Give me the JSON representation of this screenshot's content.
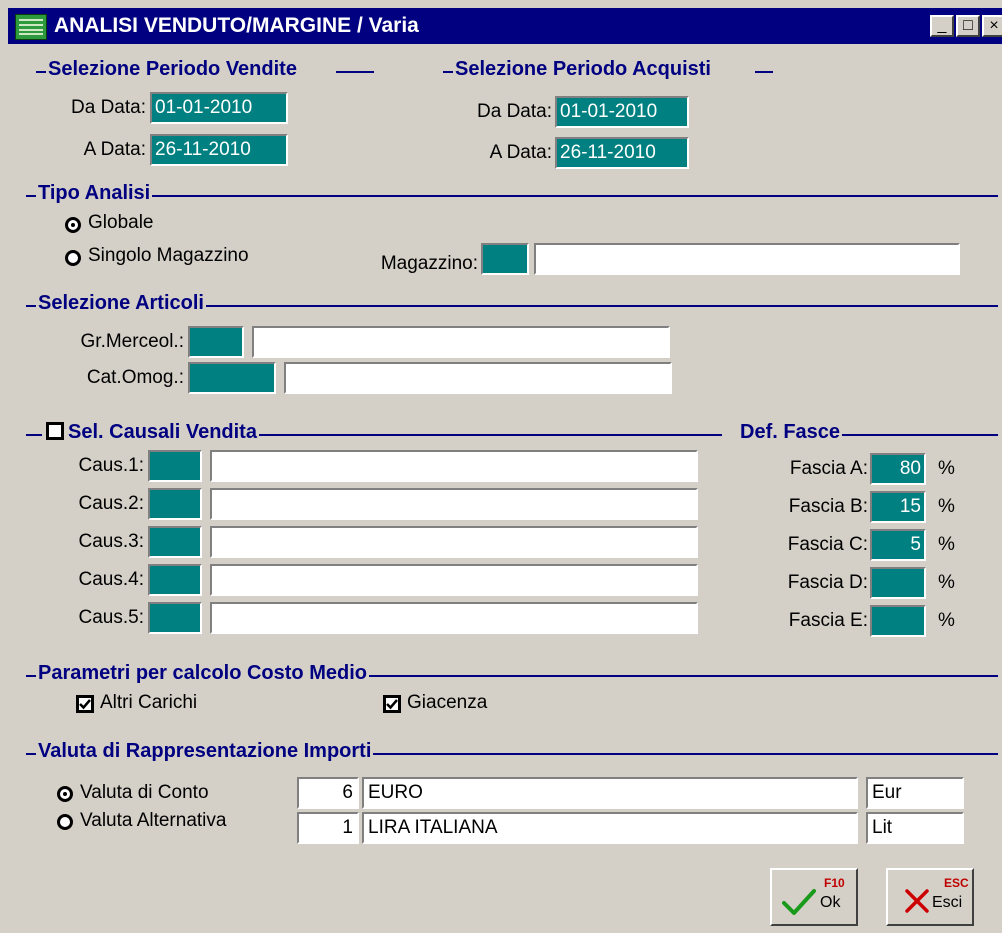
{
  "window": {
    "title": "ANALISI VENDUTO/MARGINE / Varia",
    "minimize_glyph": "_",
    "maximize_glyph": "□",
    "close_glyph": "×"
  },
  "periodo_vendite": {
    "title": "Selezione Periodo Vendite",
    "da_label": "Da Data:",
    "da_value": "01-01-2010",
    "a_label": "A Data:",
    "a_value": "26-11-2010"
  },
  "periodo_acquisti": {
    "title": "Selezione Periodo Acquisti",
    "da_label": "Da Data:",
    "da_value": "01-01-2010",
    "a_label": "A Data:",
    "a_value": "26-11-2010"
  },
  "tipo_analisi": {
    "title": "Tipo Analisi",
    "options": [
      "Globale",
      "Singolo Magazzino"
    ],
    "selected": "Globale",
    "magazzino_label": "Magazzino:",
    "magazzino_code": "",
    "magazzino_desc": ""
  },
  "selezione_articoli": {
    "title": "Selezione Articoli",
    "gr_merceol_label": "Gr.Merceol.:",
    "gr_merceol_code": "",
    "gr_merceol_desc": "",
    "cat_omog_label": "Cat.Omog.:",
    "cat_omog_code": "",
    "cat_omog_desc": ""
  },
  "causali": {
    "title": "Sel. Causali Vendita",
    "checked": false,
    "rows": [
      {
        "label": "Caus.1:",
        "code": "",
        "desc": ""
      },
      {
        "label": "Caus.2:",
        "code": "",
        "desc": ""
      },
      {
        "label": "Caus.3:",
        "code": "",
        "desc": ""
      },
      {
        "label": "Caus.4:",
        "code": "",
        "desc": ""
      },
      {
        "label": "Caus.5:",
        "code": "",
        "desc": ""
      }
    ]
  },
  "fasce": {
    "title": "Def. Fasce",
    "unit": "%",
    "rows": [
      {
        "label": "Fascia A:",
        "value": "80"
      },
      {
        "label": "Fascia B:",
        "value": "15"
      },
      {
        "label": "Fascia C:",
        "value": "5"
      },
      {
        "label": "Fascia D:",
        "value": ""
      },
      {
        "label": "Fascia E:",
        "value": ""
      }
    ]
  },
  "costo_medio": {
    "title": "Parametri per calcolo Costo Medio",
    "altri_carichi_label": "Altri Carichi",
    "altri_carichi_checked": true,
    "giacenza_label": "Giacenza",
    "giacenza_checked": true
  },
  "valuta": {
    "title": "Valuta di Rappresentazione Importi",
    "selected": "Valuta di Conto",
    "rows": [
      {
        "label": "Valuta di Conto",
        "code": "6",
        "name": "EURO",
        "symbol": "Eur"
      },
      {
        "label": "Valuta Alternativa",
        "code": "1",
        "name": "LIRA ITALIANA",
        "symbol": "Lit"
      }
    ]
  },
  "buttons": {
    "ok_key": "F10",
    "ok_label": "Ok",
    "esci_key": "ESC",
    "esci_label": "Esci"
  },
  "colors": {
    "titlebar": "#000080",
    "group_title": "#000080",
    "field_teal": "#008080",
    "ok_check": "#1a9a1a",
    "esci_cross": "#cc0000",
    "fkey": "#c00000"
  },
  "icons": {
    "app": "grid-window-icon",
    "ok": "checkmark-icon",
    "esci": "cross-icon"
  }
}
